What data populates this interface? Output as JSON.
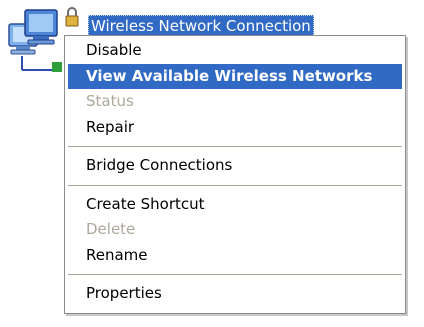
{
  "desktop_item": {
    "icon": "wireless-network-connection-icon",
    "label": "Wireless Network Connection"
  },
  "context_menu": {
    "items": [
      {
        "label": "Disable",
        "state": "normal"
      },
      {
        "label": "View Available Wireless Networks",
        "state": "highlighted-default"
      },
      {
        "label": "Status",
        "state": "disabled"
      },
      {
        "label": "Repair",
        "state": "normal"
      },
      {
        "label": "Bridge Connections",
        "state": "normal"
      },
      {
        "label": "Create Shortcut",
        "state": "normal"
      },
      {
        "label": "Delete",
        "state": "disabled"
      },
      {
        "label": "Rename",
        "state": "normal"
      },
      {
        "label": "Properties",
        "state": "normal"
      }
    ]
  },
  "colors": {
    "selection": "#316ac5",
    "disabled_text": "#aca899",
    "menu_border": "#8c8c8c"
  }
}
